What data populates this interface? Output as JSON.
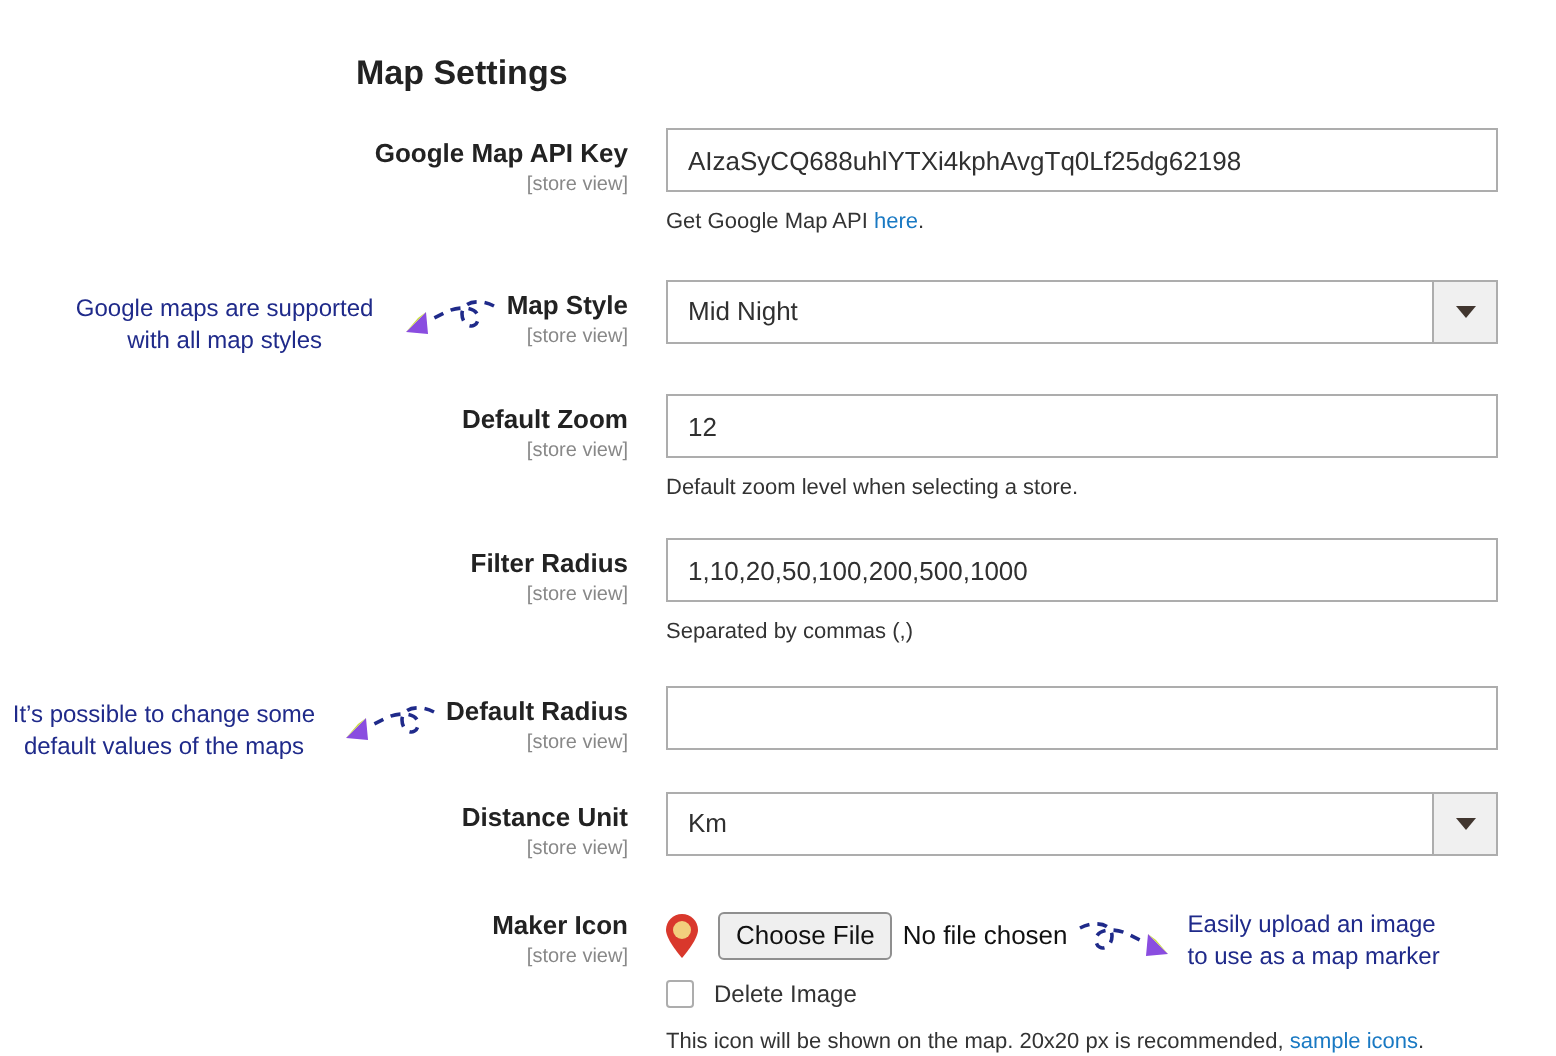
{
  "title": "Map Settings",
  "fields": [
    {
      "kind": "text",
      "label": "Google Map API Key",
      "scope": "[store view]",
      "value": "AIzaSyCQ688uhlYTXi4kphAvgTq0Lf25dg62198",
      "note": "Get Google Map API ",
      "note_link": "here",
      "note_end": "."
    },
    {
      "kind": "select",
      "label": "Map Style",
      "scope": "[store view]",
      "value": "Mid Night",
      "callout": "Google maps are supported with all map styles"
    },
    {
      "kind": "text",
      "label": "Default Zoom",
      "scope": "[store view]",
      "value": "12",
      "note": "Default zoom level when selecting a store."
    },
    {
      "kind": "text",
      "label": "Filter Radius",
      "scope": "[store view]",
      "value": "1,10,20,50,100,200,500,1000",
      "note": "Separated by commas (,)"
    },
    {
      "kind": "text",
      "label": "Default Radius",
      "scope": "[store view]",
      "callout": "It’s possible to change some default values of the maps"
    },
    {
      "kind": "select",
      "label": "Distance Unit",
      "scope": "[store view]",
      "value": "Km"
    },
    {
      "kind": "file",
      "label": "Maker Icon",
      "scope": "[store view]",
      "button": "Choose File",
      "file_status": "No file chosen",
      "checkbox": {
        "label": "Delete Image",
        "checked": false
      },
      "callout": "Easily upload an image to use as a map marker",
      "note": "This icon will be shown on the map. 20x20 px is recommended, ",
      "note_link": "sample icons",
      "note_end": "."
    }
  ]
}
